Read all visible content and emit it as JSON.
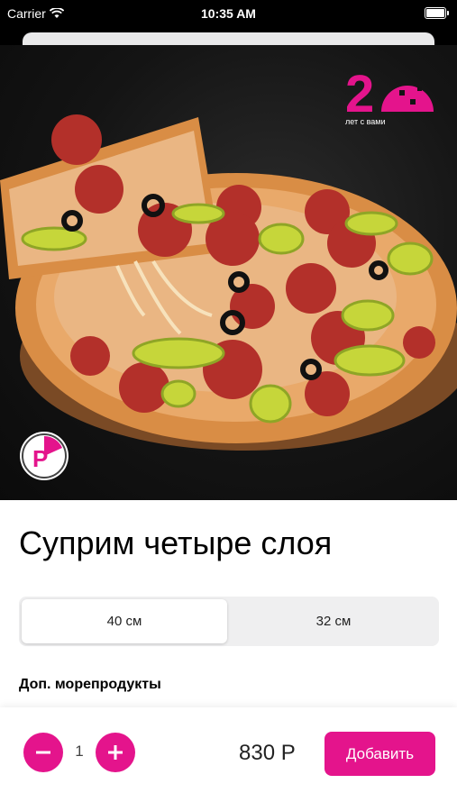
{
  "status_bar": {
    "carrier": "Carrier",
    "time": "10:35 AM"
  },
  "hero": {
    "badge_number": "20",
    "badge_caption": "лет с вами",
    "corner_logo_letter": "P"
  },
  "product": {
    "title": "Суприм четыре слоя",
    "sizes": [
      "40 см",
      "32 см"
    ],
    "selected_size": "40 см",
    "extras_label": "Доп. морепродукты"
  },
  "order": {
    "quantity": "1",
    "price": "830 Р",
    "add_label": "Добавить"
  },
  "colors": {
    "accent": "#e4148c",
    "segment_bg": "#efeff0"
  }
}
